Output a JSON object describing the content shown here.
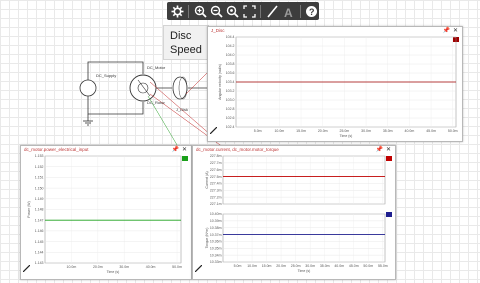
{
  "toolbar": {
    "tools": [
      "settings",
      "zoom-in",
      "zoom-out",
      "zoom-reset",
      "fit-screen",
      "wire",
      "text",
      "help"
    ]
  },
  "tooltip": {
    "line1": "Disc",
    "line2": "Speed"
  },
  "schematic": {
    "source_label": "DC_Supply",
    "motor_label": "DC_Motor",
    "motor_label2": "DC_Rotor",
    "disc_label": "J_Disk"
  },
  "panels": {
    "speed": {
      "title": "J_Disc",
      "legend_color": "#a00000",
      "ylabel": "Angular velocity (rad/s)",
      "xlabel": "Time (s)",
      "yticks": [
        "104.4",
        "104.2",
        "104.0",
        "103.8",
        "103.6",
        "103.4",
        "103.2",
        "103.0",
        "102.8",
        "102.6",
        "102.4"
      ],
      "xticks": [
        "5.0m",
        "10.0m",
        "15.0m",
        "20.0m",
        "25.0m",
        "30.0m",
        "35.0m",
        "40.0m",
        "45.0m",
        "50.0m"
      ]
    },
    "power": {
      "title": "dc_motor.power_electrical_input",
      "legend_color": "#1aa01a",
      "ylabel": "Power (W)",
      "xlabel": "Time (s)",
      "yticks": [
        "1.153",
        "1.152",
        "1.151",
        "1.150",
        "1.149",
        "1.148",
        "1.147",
        "1.146",
        "1.145",
        "1.144",
        "1.143"
      ],
      "xticks": [
        "10.0m",
        "20.0m",
        "30.0m",
        "40.0m",
        "50.0m"
      ]
    },
    "current": {
      "title": "dc_motor.current, dc_motor.motor_torque",
      "legend_color": "#c00000",
      "legend_color2": "#1f1f8f",
      "ylabel_top": "Current (A)",
      "ylabel_bottom": "Torque (N*m)",
      "xlabel": "Time (s)",
      "yticks_top": [
        "227.8m",
        "227.7m",
        "227.6m",
        "227.5m",
        "227.4m",
        "227.3m",
        "227.2m",
        "227.1m"
      ],
      "yticks_bottom": [
        "10.40m",
        "10.39m",
        "10.38m",
        "10.37m",
        "10.36m",
        "10.35m",
        "10.34m",
        "10.33m"
      ],
      "xticks": [
        "5.0m",
        "10.0m",
        "15.0m",
        "20.0m",
        "25.0m",
        "30.0m",
        "35.0m",
        "40.0m",
        "45.0m",
        "50.0m",
        "55.0m"
      ]
    }
  }
}
